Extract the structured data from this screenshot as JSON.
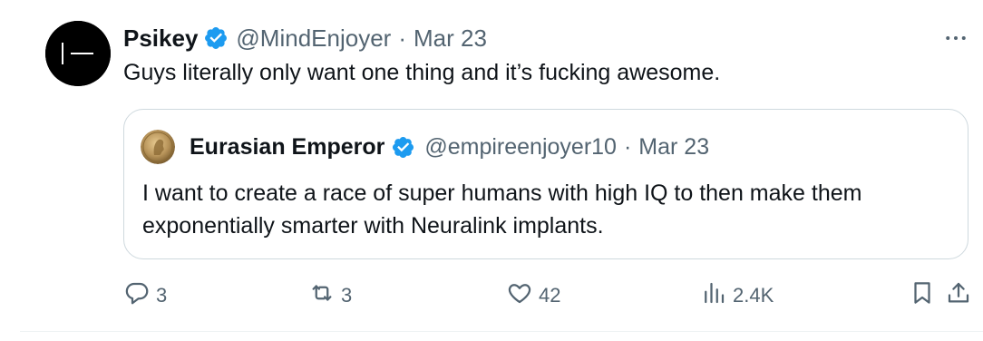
{
  "tweet": {
    "author": {
      "name": "Psikey",
      "handle": "@MindEnjoyer",
      "date": "Mar 23"
    },
    "separator": "·",
    "text": "Guys literally only want one thing and it’s fucking awesome.",
    "quote": {
      "author": {
        "name": "Eurasian Emperor",
        "handle": "@empireenjoyer10",
        "date": "Mar 23"
      },
      "separator": "·",
      "lines": [
        "I want to create a race of super humans with high IQ to then make them",
        "exponentially smarter with Neuralink implants."
      ]
    },
    "actions": {
      "replies": "3",
      "reposts": "3",
      "likes": "42",
      "views": "2.4K"
    }
  },
  "colors": {
    "verified": "#1d9bf0",
    "secondary_text": "#536471",
    "border": "#cfd9de"
  },
  "icons": {
    "verified": "verified-badge-icon",
    "more": "more-icon",
    "reply": "reply-icon",
    "repost": "repost-icon",
    "like": "heart-icon",
    "views": "views-icon",
    "bookmark": "bookmark-icon",
    "share": "share-icon"
  }
}
